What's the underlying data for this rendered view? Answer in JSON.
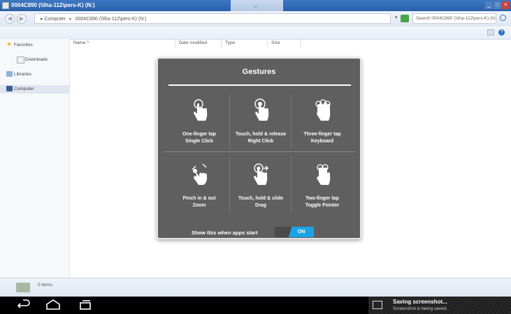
{
  "window": {
    "title": "0004C890 (\\\\lha-112\\pers-K) (N:)",
    "tab_glyph": "⌵"
  },
  "address": {
    "segments": [
      "Computer",
      "0004C890 (\\\\lha-112\\pers-K) (N:)"
    ],
    "search_placeholder": "Search 0004C890 (\\\\lha-112\\pers-K) (N:)"
  },
  "nav": {
    "items": [
      {
        "label": "Favorites"
      },
      {
        "label": "Downloads"
      },
      {
        "label": "Libraries"
      },
      {
        "label": "Computer"
      }
    ]
  },
  "columns": [
    "Name",
    "Date modified",
    "Type",
    "Size"
  ],
  "status": {
    "items_text": "0 items"
  },
  "gestures": {
    "title": "Gestures",
    "items": [
      {
        "label": "One-finger tap",
        "action": "Single Click",
        "icon": "one-finger-tap-icon"
      },
      {
        "label": "Touch, hold & release",
        "action": "Right Click",
        "icon": "touch-hold-release-icon"
      },
      {
        "label": "Three-finger tap",
        "action": "Keyboard",
        "icon": "three-finger-tap-icon"
      },
      {
        "label": "Pinch in & out",
        "action": "Zoom",
        "icon": "pinch-icon"
      },
      {
        "label": "Touch, hold & slide",
        "action": "Drag",
        "icon": "touch-hold-slide-icon"
      },
      {
        "label": "Two-finger tap",
        "action": "Toggle Pointer",
        "icon": "two-finger-tap-icon"
      }
    ],
    "show_label": "Show this when apps start",
    "toggle_label": "ON"
  },
  "notification": {
    "title": "Saving screenshot...",
    "subtitle": "Screenshot is being saved."
  },
  "colors": {
    "accent": "#1aa3e6",
    "overlay_bg": "#5f5f5f",
    "titlebar": "#2a5fa8"
  }
}
